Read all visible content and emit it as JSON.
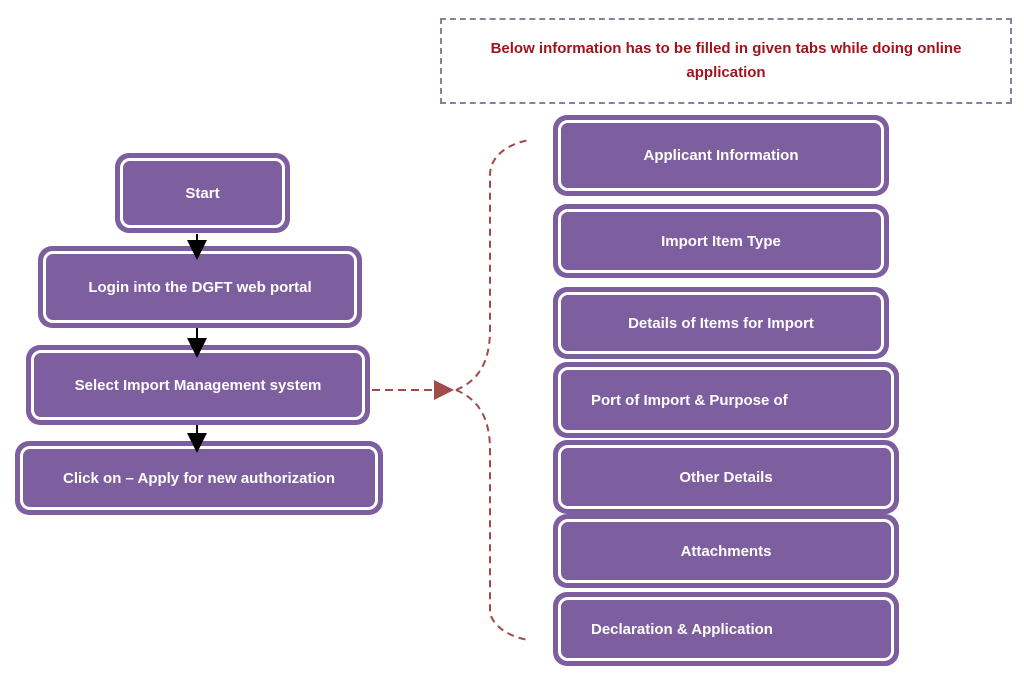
{
  "note": {
    "text": "Below information has to be filled in given tabs while doing online application"
  },
  "flow_steps": [
    {
      "label": "Start"
    },
    {
      "label": "Login into the DGFT web portal"
    },
    {
      "label": "Select Import Management system"
    },
    {
      "label": "Click on – Apply for new authorization"
    }
  ],
  "tabs": [
    {
      "label": "Applicant Information"
    },
    {
      "label": "Import Item Type"
    },
    {
      "label": "Details of Items for Import"
    },
    {
      "label": "Port of Import & Purpose of"
    },
    {
      "label": "Other Details"
    },
    {
      "label": "Attachments"
    },
    {
      "label": "Declaration & Application"
    }
  ],
  "colors": {
    "box_fill": "#7d5fa0",
    "note_text": "#a0141e",
    "connector": "#a04a4a"
  }
}
